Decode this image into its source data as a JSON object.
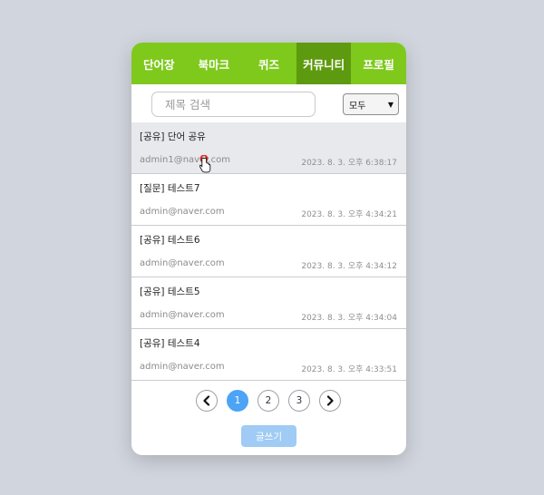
{
  "nav": {
    "tabs": [
      {
        "label": "단어장"
      },
      {
        "label": "북마크"
      },
      {
        "label": "퀴즈"
      },
      {
        "label": "커뮤니티"
      },
      {
        "label": "프로필"
      }
    ],
    "active_index": 3,
    "color": "#7ec91c",
    "active_color": "#5e9a0f"
  },
  "search": {
    "placeholder": "제목 검색",
    "value": ""
  },
  "filter": {
    "selected": "모두"
  },
  "posts": [
    {
      "title": "[공유] 단어 공유",
      "author": "admin1@naver.com",
      "date": "2023. 8. 3. 오후 6:38:17"
    },
    {
      "title": "[질문] 테스트7",
      "author": "admin@naver.com",
      "date": "2023. 8. 3. 오후 4:34:21"
    },
    {
      "title": "[공유] 테스트6",
      "author": "admin@naver.com",
      "date": "2023. 8. 3. 오후 4:34:12"
    },
    {
      "title": "[공유] 테스트5",
      "author": "admin@naver.com",
      "date": "2023. 8. 3. 오후 4:34:04"
    },
    {
      "title": "[공유] 테스트4",
      "author": "admin@naver.com",
      "date": "2023. 8. 3. 오후 4:33:51"
    }
  ],
  "pagination": {
    "pages": [
      "1",
      "2",
      "3"
    ],
    "current": "1",
    "active_color": "#4da3f5"
  },
  "write_button": {
    "label": "글쓰기",
    "color": "#9fcbf5"
  }
}
